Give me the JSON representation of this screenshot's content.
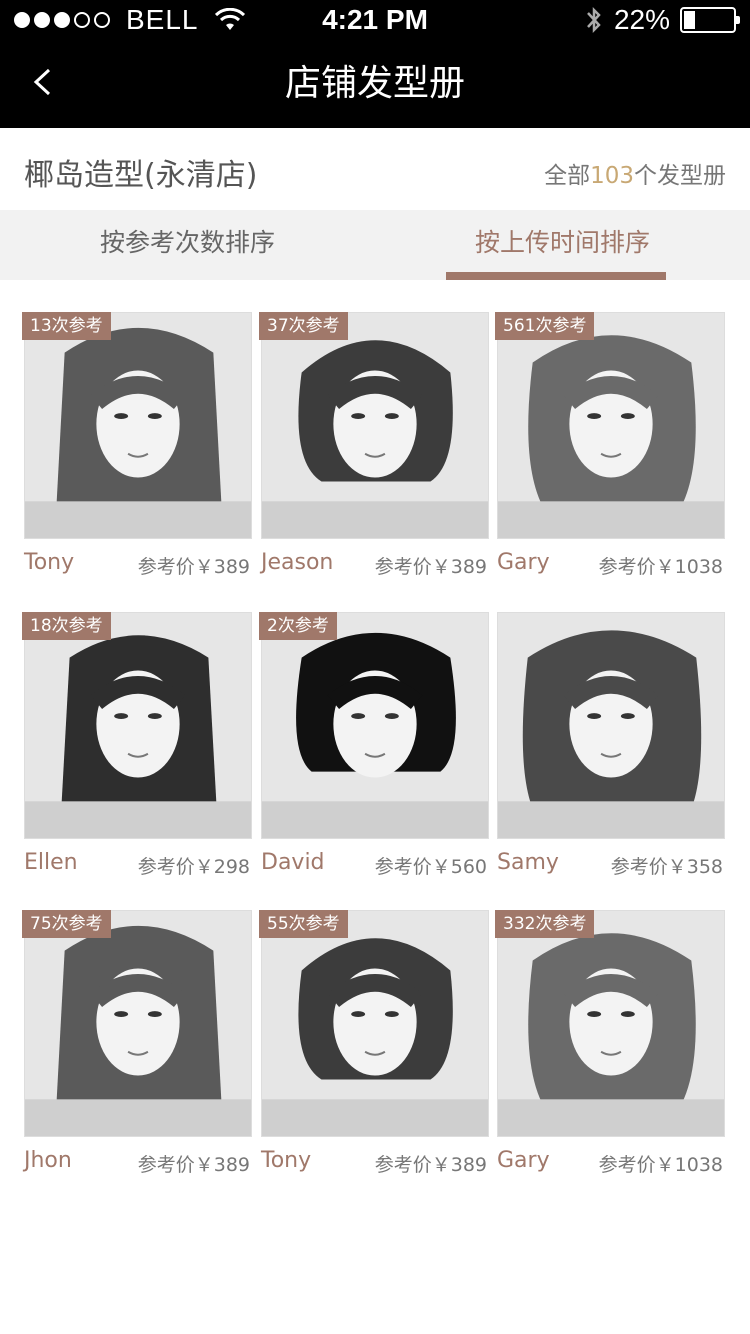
{
  "status": {
    "carrier": "BELL",
    "time": "4:21 PM",
    "battery": "22%"
  },
  "navbar": {
    "back_label": "<",
    "title": "店铺发型册"
  },
  "shop": {
    "name": "椰岛造型(永清店)",
    "count_prefix": "全部",
    "count": "103",
    "count_suffix": "个发型册"
  },
  "tabs": [
    {
      "label": "按参考次数排序"
    },
    {
      "label": "按上传时间排序"
    }
  ],
  "hairstyles": [
    {
      "refs": "13次参考",
      "stylist": "Tony",
      "price": "参考价￥389",
      "photo": "long-wavy-hair-photo"
    },
    {
      "refs": "37次参考",
      "stylist": "Jeason",
      "price": "参考价￥389",
      "photo": "short-curly-hair-photo"
    },
    {
      "refs": "561次参考",
      "stylist": "Gary",
      "price": "参考价￥1038",
      "photo": "medium-wavy-hair-photo"
    },
    {
      "refs": "18次参考",
      "stylist": "Ellen",
      "price": "参考价￥298",
      "photo": "long-straight-hair-photo"
    },
    {
      "refs": "2次参考",
      "stylist": "David",
      "price": "参考价￥560",
      "photo": "bob-bangs-hair-photo"
    },
    {
      "refs": "",
      "stylist": "Samy",
      "price": "参考价￥358",
      "photo": "wavy-bangs-hair-photo"
    },
    {
      "refs": "75次参考",
      "stylist": "Jhon",
      "price": "参考价￥389",
      "photo": "long-wavy-hair-photo"
    },
    {
      "refs": "55次参考",
      "stylist": "Tony",
      "price": "参考价￥389",
      "photo": "short-curly-hair-photo"
    },
    {
      "refs": "332次参考",
      "stylist": "Gary",
      "price": "参考价￥1038",
      "photo": "medium-wavy-hair-photo"
    }
  ]
}
